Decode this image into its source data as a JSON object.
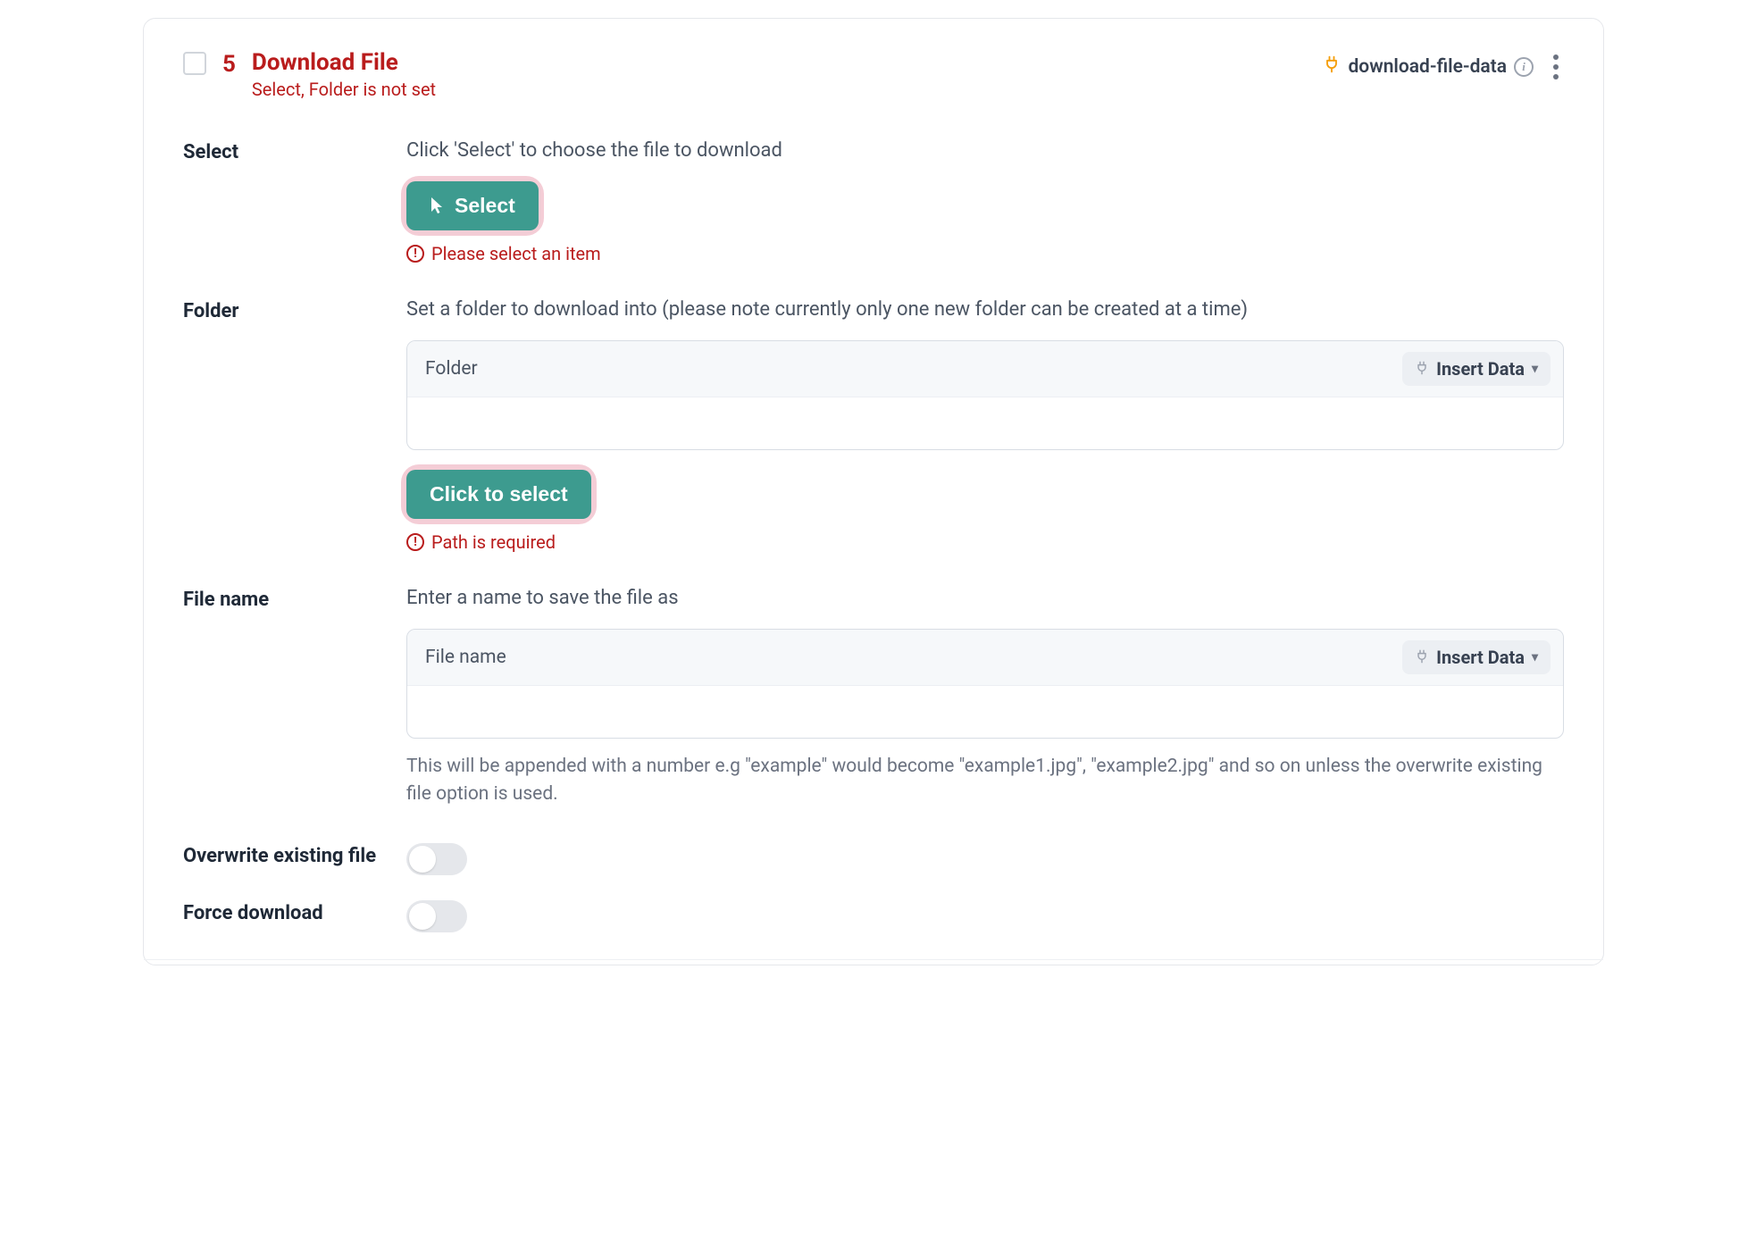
{
  "header": {
    "step_number": "5",
    "title": "Download File",
    "subtitle": "Select, Folder is not set",
    "tag": "download-file-data"
  },
  "fields": {
    "select": {
      "label": "Select",
      "desc": "Click 'Select' to choose the file to download",
      "button": "Select",
      "error": "Please select an item"
    },
    "folder": {
      "label": "Folder",
      "desc": "Set a folder to download into (please note currently only one new folder can be created at a time)",
      "input_label": "Folder",
      "insert_label": "Insert Data",
      "button": "Click to select",
      "error": "Path is required"
    },
    "filename": {
      "label": "File name",
      "desc": "Enter a name to save the file as",
      "input_label": "File name",
      "insert_label": "Insert Data",
      "help": "This will be appended with a number e.g \"example\" would become \"example1.jpg\", \"example2.jpg\" and so on unless the overwrite existing file option is used."
    },
    "overwrite": {
      "label": "Overwrite existing file"
    },
    "force": {
      "label": "Force download"
    }
  }
}
